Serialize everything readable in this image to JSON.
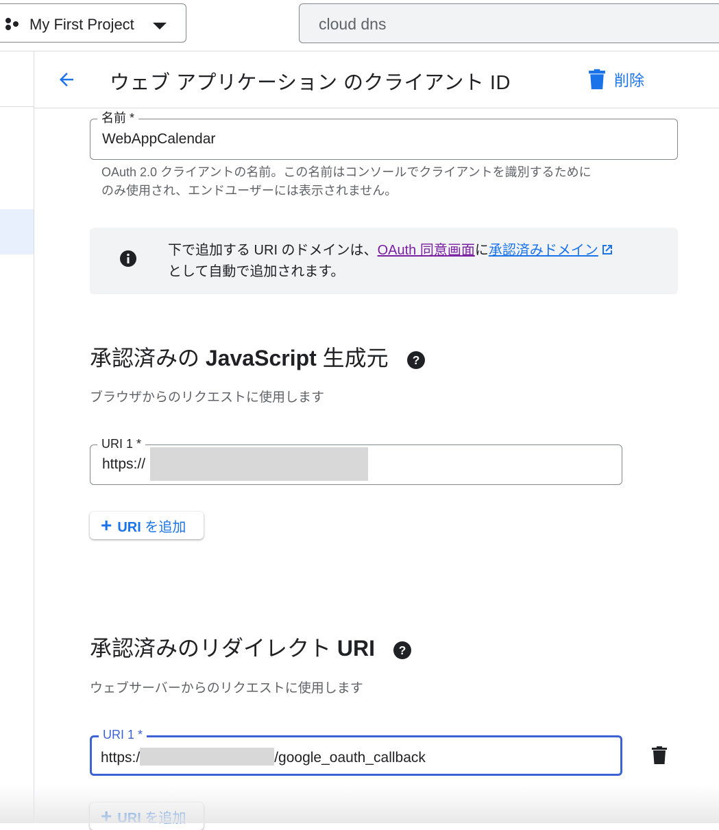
{
  "topbar": {
    "project_name": "My First Project",
    "search_value": "cloud dns"
  },
  "header": {
    "title": "ウェブ アプリケーション のクライアント ID",
    "delete_label": "削除"
  },
  "name_field": {
    "label": "名前 *",
    "value": "WebAppCalendar",
    "helper_line1": "OAuth 2.0 クライアントの名前。この名前はコンソールでクライアントを識別するために",
    "helper_line2": "のみ使用され、エンドユーザーには表示されません。"
  },
  "info": {
    "text_before": "下で追加する URI のドメインは、",
    "link1": "OAuth 同意画面",
    "text_mid": "に",
    "link2": "承認済みドメイン",
    "text_after": "として自動で追加されます。"
  },
  "js_origins": {
    "title_prefix": "承認済みの",
    "title_bold": "JavaScript",
    "title_suffix": "生成元",
    "subtitle": "ブラウザからのリクエストに使用します",
    "field_label": "URI 1 *",
    "field_value": "https://",
    "add_label_bold": "URI",
    "add_label_rest": "を追加"
  },
  "redirect_uris": {
    "title_prefix": "承認済みのリダイレクト",
    "title_bold": "URI",
    "subtitle": "ウェブサーバーからのリクエストに使用します",
    "field_label": "URI 1 *",
    "field_value_prefix": "https:/",
    "field_value_suffix": "/google_oauth_callback",
    "add_label_bold": "URI",
    "add_label_rest": "を追加"
  },
  "colors": {
    "accent": "#1a73e8",
    "focus": "#3c63d1",
    "visited_link": "#7b1fa2",
    "info_bg": "#f1f3f4"
  },
  "icons": [
    "hexagon-cluster-icon",
    "caret-down-icon",
    "arrow-back-icon",
    "trash-icon",
    "info-icon",
    "external-link-icon",
    "help-icon",
    "plus-icon"
  ]
}
